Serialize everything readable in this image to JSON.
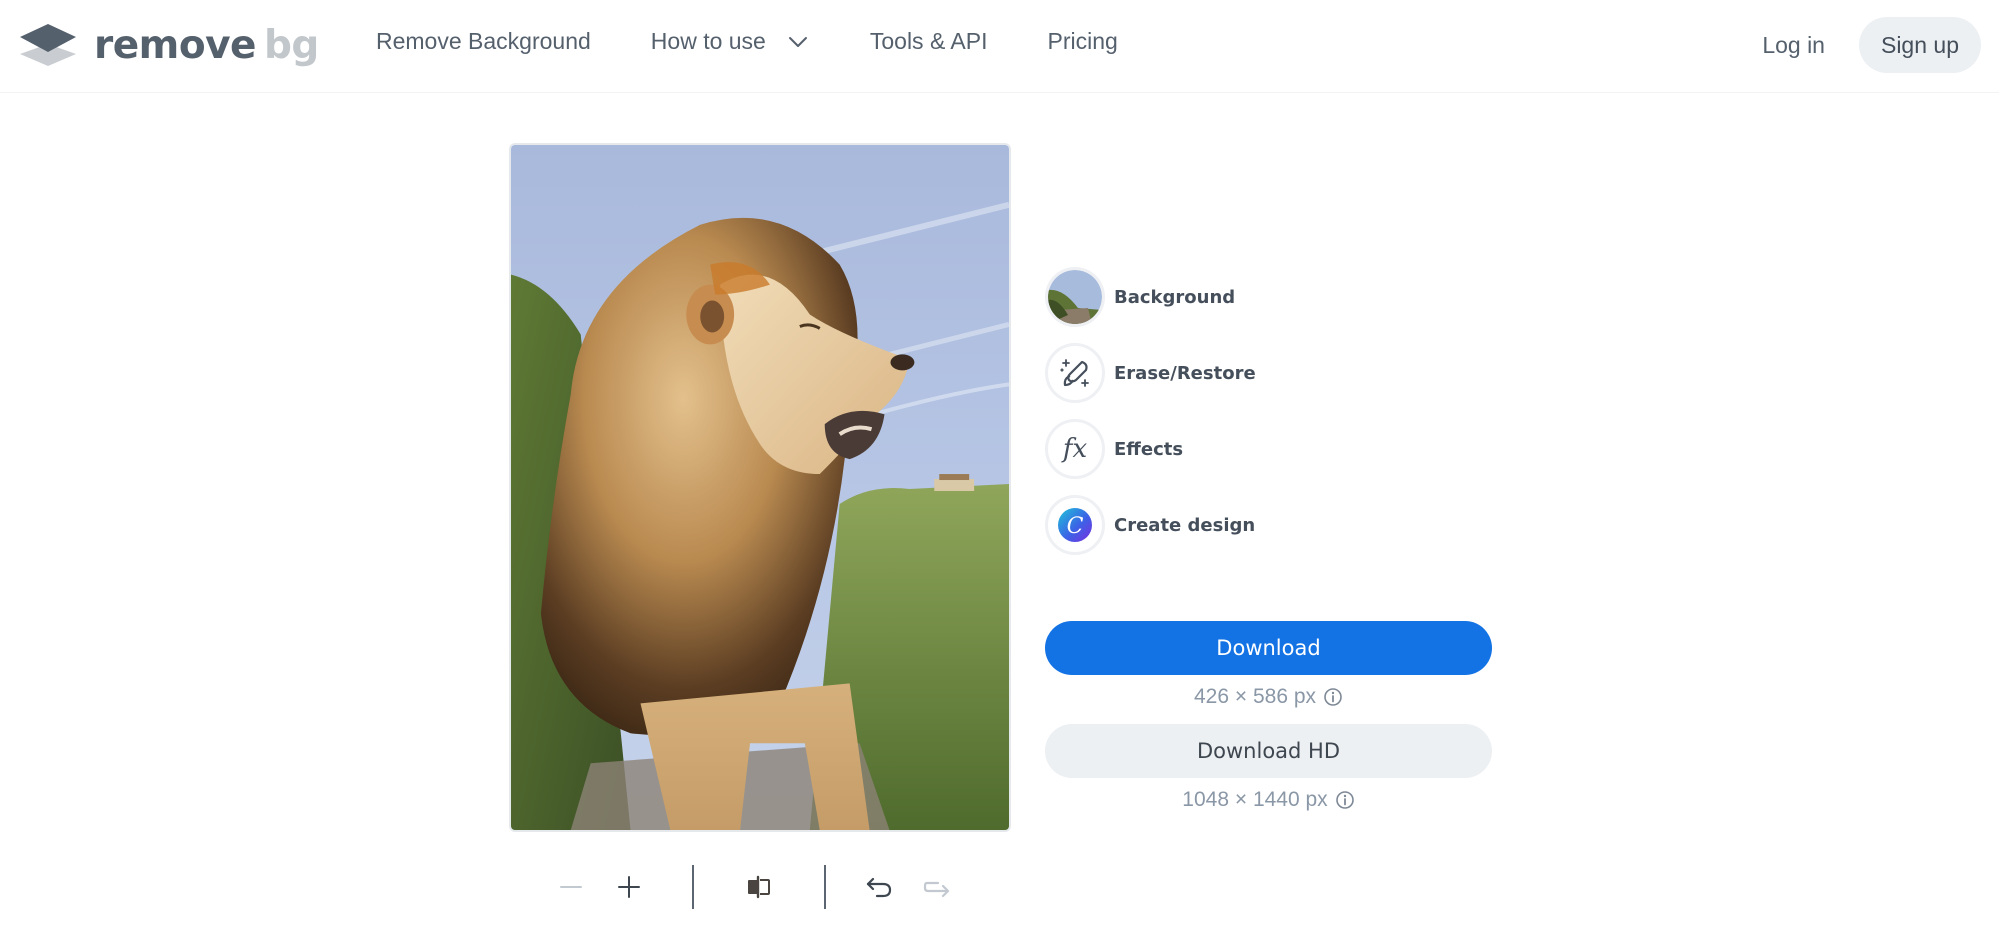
{
  "header": {
    "logo": {
      "word1": "remove",
      "word2": "bg",
      "icon": "layers-logo-icon"
    },
    "nav": [
      {
        "label": "Remove Background"
      },
      {
        "label": "How to use",
        "icon": "chevron-down-icon"
      },
      {
        "label": "Tools & API"
      },
      {
        "label": "Pricing"
      }
    ],
    "login_label": "Log in",
    "signup_label": "Sign up"
  },
  "preview": {
    "alt": "Lion standing on grassy hillside under blue sky (background removed preview)"
  },
  "tools": [
    {
      "label": "Background",
      "icon": "background-thumbnail-icon"
    },
    {
      "label": "Erase/Restore",
      "icon": "magic-brush-icon"
    },
    {
      "label": "Effects",
      "icon": "fx-icon",
      "glyph": "fx"
    },
    {
      "label": "Create design",
      "icon": "canva-icon",
      "glyph": "C"
    }
  ],
  "downloads": {
    "primary_label": "Download",
    "primary_dims": "426 × 586 px",
    "hd_label": "Download HD",
    "hd_dims": "1048 × 1440 px"
  },
  "toolbar": {
    "items": [
      "zoom-out-icon",
      "zoom-in-icon",
      "compare-icon",
      "undo-icon",
      "redo-icon"
    ],
    "zoom_out_enabled": false,
    "redo_enabled": false
  },
  "colors": {
    "primary": "#1373e4",
    "secondary_bg": "#edf0f3",
    "text": "#454f5b",
    "muted": "#8a97a6"
  }
}
